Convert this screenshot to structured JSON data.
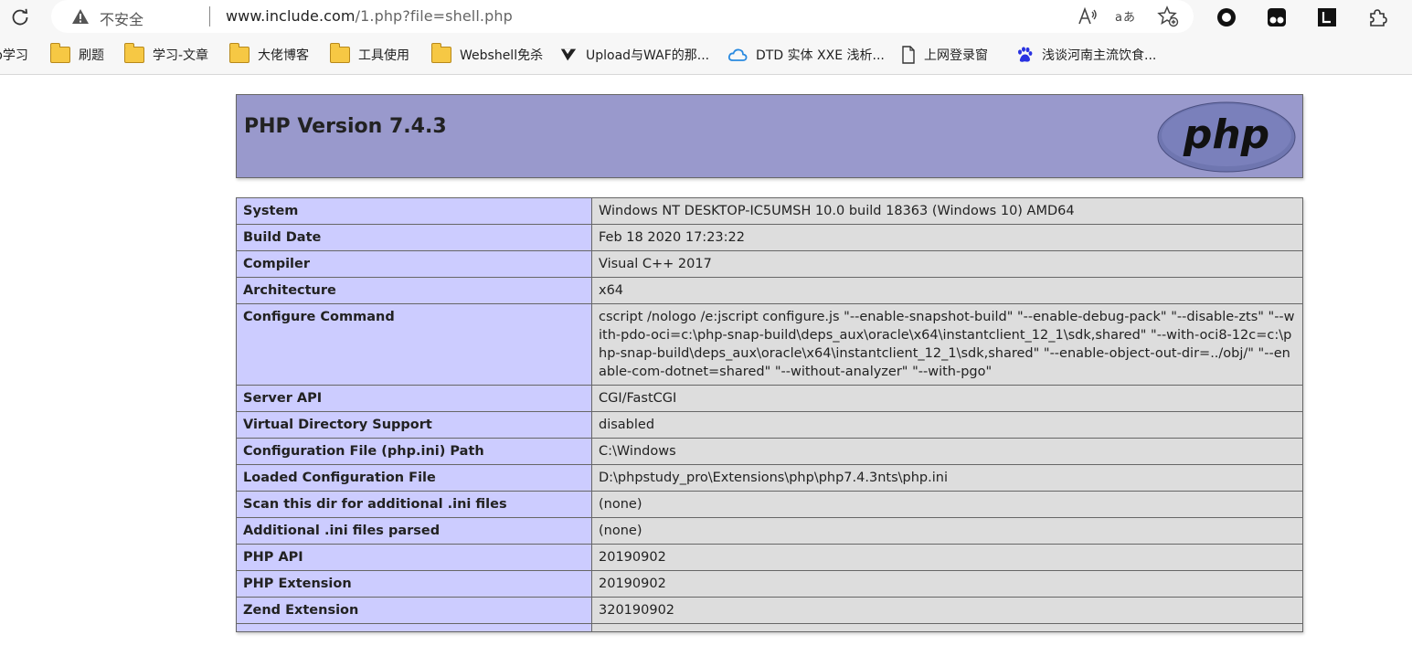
{
  "browser": {
    "security_label": "不安全",
    "url_host": "www.include.com",
    "url_path": "/1.php?file=shell.php",
    "read_aloud_icon": "read-aloud-icon",
    "translate_icon": "translate-icon",
    "favorite_icon": "add-favorite-icon",
    "extensions": [
      "circle-extension-icon",
      "tampermonkey-icon",
      "dark-reader-icon",
      "puzzle-extensions-icon"
    ]
  },
  "bookmarks": [
    {
      "label": "b学习",
      "icon": "folder-icon"
    },
    {
      "label": "刷题",
      "icon": "folder-icon"
    },
    {
      "label": "学习-文章",
      "icon": "folder-icon"
    },
    {
      "label": "大佬博客",
      "icon": "folder-icon"
    },
    {
      "label": "工具使用",
      "icon": "folder-icon"
    },
    {
      "label": "Webshell免杀",
      "icon": "folder-icon"
    },
    {
      "label": "Upload与WAF的那...",
      "icon": "site-icon"
    },
    {
      "label": "DTD 实体 XXE 浅析...",
      "icon": "cloud-icon"
    },
    {
      "label": "上网登录窗",
      "icon": "page-icon"
    },
    {
      "label": "浅谈河南主流饮食...",
      "icon": "baidu-paw-icon"
    }
  ],
  "phpinfo": {
    "title": "PHP Version 7.4.3",
    "logo_text": "php",
    "rows": [
      {
        "key": "System",
        "value": "Windows NT DESKTOP-IC5UMSH 10.0 build 18363 (Windows 10) AMD64"
      },
      {
        "key": "Build Date",
        "value": "Feb 18 2020 17:23:22"
      },
      {
        "key": "Compiler",
        "value": "Visual C++ 2017"
      },
      {
        "key": "Architecture",
        "value": "x64"
      },
      {
        "key": "Configure Command",
        "value": "cscript /nologo /e:jscript configure.js \"--enable-snapshot-build\" \"--enable-debug-pack\" \"--disable-zts\" \"--with-pdo-oci=c:\\php-snap-build\\deps_aux\\oracle\\x64\\instantclient_12_1\\sdk,shared\" \"--with-oci8-12c=c:\\php-snap-build\\deps_aux\\oracle\\x64\\instantclient_12_1\\sdk,shared\" \"--enable-object-out-dir=../obj/\" \"--enable-com-dotnet=shared\" \"--without-analyzer\" \"--with-pgo\""
      },
      {
        "key": "Server API",
        "value": "CGI/FastCGI"
      },
      {
        "key": "Virtual Directory Support",
        "value": "disabled"
      },
      {
        "key": "Configuration File (php.ini) Path",
        "value": "C:\\Windows"
      },
      {
        "key": "Loaded Configuration File",
        "value": "D:\\phpstudy_pro\\Extensions\\php\\php7.4.3nts\\php.ini"
      },
      {
        "key": "Scan this dir for additional .ini files",
        "value": "(none)"
      },
      {
        "key": "Additional .ini files parsed",
        "value": "(none)"
      },
      {
        "key": "PHP API",
        "value": "20190902"
      },
      {
        "key": "PHP Extension",
        "value": "20190902"
      },
      {
        "key": "Zend Extension",
        "value": "320190902"
      },
      {
        "key": "",
        "value": ""
      }
    ]
  },
  "colors": {
    "header_bg": "#9999cc",
    "key_bg": "#ccccff",
    "value_bg": "#dddddd",
    "border": "#666666"
  }
}
